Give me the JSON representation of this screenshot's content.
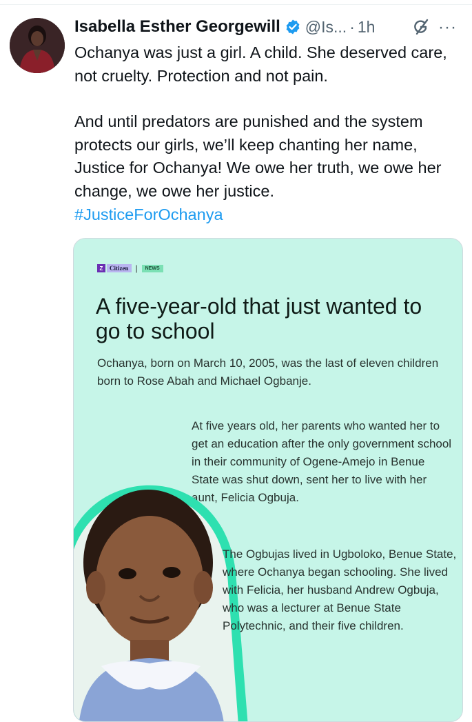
{
  "tweet": {
    "author_name": "Isabella Esther Georgewill",
    "handle": "@Is...",
    "separator": "·",
    "time": "1h",
    "paragraphs": [
      "Ochanya was just a girl. A child. She deserved care, not cruelty. Protection and not pain.",
      "And until predators are punished and the system protects our girls, we’ll keep chanting her name, Justice for Ochanya! We owe her truth, we owe her change, we owe her justice."
    ],
    "hashtag": "#JusticeForOchanya",
    "more_label": "···"
  },
  "media_card": {
    "brand_mark": "Z",
    "brand": "Citizen",
    "divider": "|",
    "section": "NEWS",
    "headline": "A five-year-old that just wanted to go to school",
    "intro": "Ochanya, born on March 10, 2005, was the last of eleven children born to Rose Abah and Michael Ogbanje.",
    "paragraph_1": "At five years old, her parents who wanted her to get an education after the only government school in their community of Ogene-Amejo in Benue State was shut down, sent her to live with her aunt, Felicia Ogbuja.",
    "paragraph_2": "The Ogbujas lived in Ugboloko, Benue State, where Ochanya began schooling. She lived with Felicia, her husband Andrew Ogbuja, who was a lecturer at Benue State Polytechnic, and their five children."
  },
  "icons": {
    "verified": "verified-badge-icon",
    "grok": "grok-icon",
    "more": "more-icon"
  },
  "colors": {
    "accent": "#1d9bf0",
    "card_background": "#c6f5e8",
    "text": "#0f1419",
    "muted": "#536471"
  }
}
